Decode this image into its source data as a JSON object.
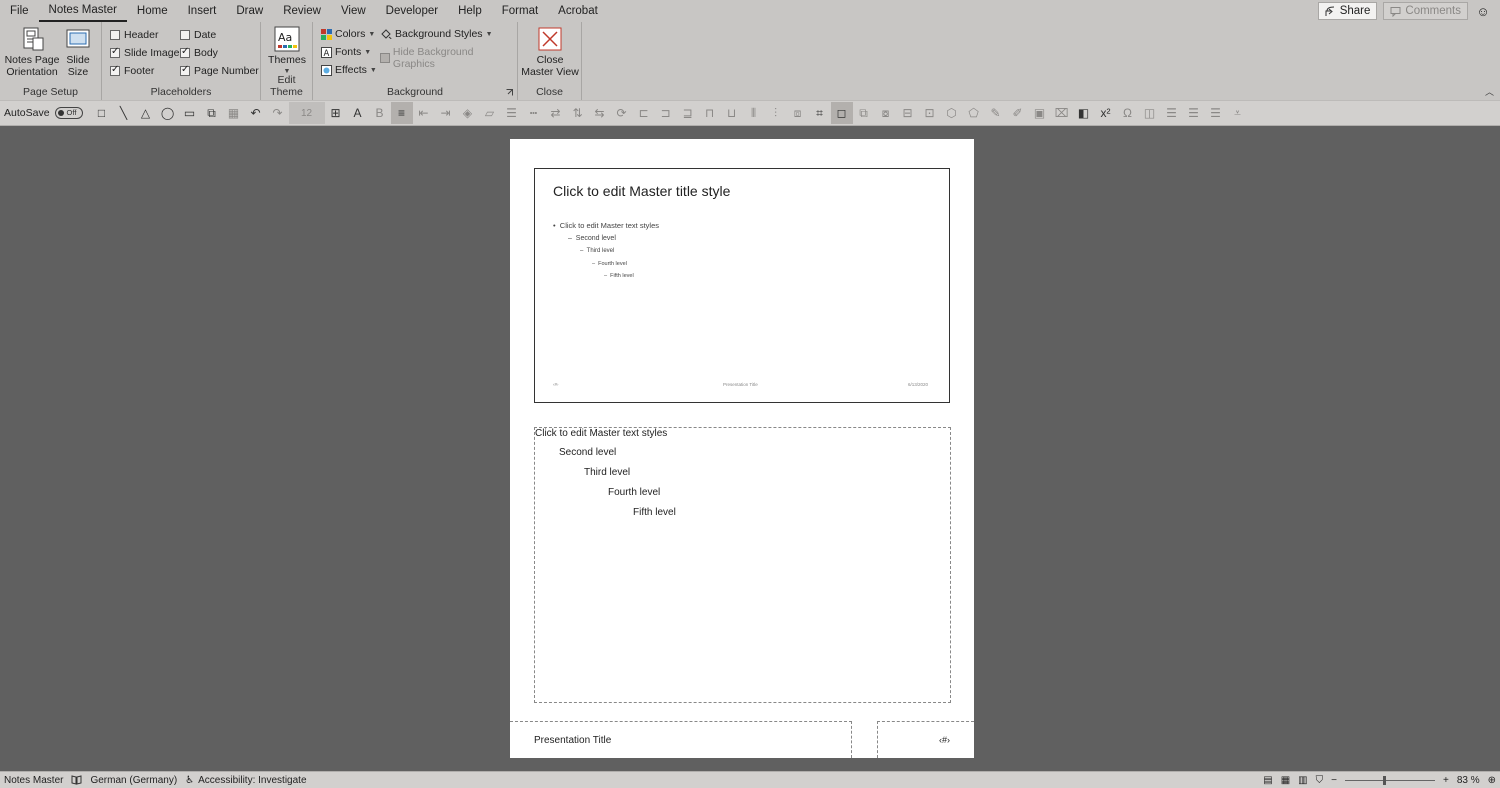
{
  "tabs": [
    "File",
    "Notes Master",
    "Home",
    "Insert",
    "Draw",
    "Review",
    "View",
    "Developer",
    "Help",
    "Format",
    "Acrobat"
  ],
  "active_tab": "Notes Master",
  "header_right": {
    "share": "Share",
    "comments": "Comments"
  },
  "ribbon": {
    "page_setup": {
      "notes_page_orientation": "Notes Page\nOrientation",
      "slide_size": "Slide\nSize",
      "label": "Page Setup"
    },
    "placeholders": {
      "items": [
        {
          "label": "Header",
          "checked": false
        },
        {
          "label": "Slide Image",
          "checked": true
        },
        {
          "label": "Footer",
          "checked": true
        },
        {
          "label": "Date",
          "checked": false
        },
        {
          "label": "Body",
          "checked": true
        },
        {
          "label": "Page Number",
          "checked": true
        }
      ],
      "label": "Placeholders"
    },
    "edit_theme": {
      "themes": "Themes",
      "label": "Edit Theme"
    },
    "background": {
      "colors": "Colors",
      "fonts": "Fonts",
      "effects": "Effects",
      "background_styles": "Background Styles",
      "hide_background_graphics": "Hide Background Graphics",
      "label": "Background"
    },
    "close": {
      "close_master_view": "Close\nMaster View",
      "label": "Close"
    }
  },
  "qat": {
    "autosave": "AutoSave",
    "toggle": "Off",
    "font_size": "12"
  },
  "slide": {
    "title": "Click to edit Master title style",
    "levels": [
      "Click to edit Master text styles",
      "Second level",
      "Third level",
      "Fourth level",
      "Fifth level"
    ],
    "footer_left": "‹#›",
    "footer_center": "Presentation Title",
    "footer_right": "6/13/2020"
  },
  "notes": {
    "levels": [
      "Click to edit Master text styles",
      "Second level",
      "Third level",
      "Fourth level",
      "Fifth level"
    ]
  },
  "page_footer": {
    "title": "Presentation Title",
    "number": "‹#›"
  },
  "status": {
    "mode": "Notes Master",
    "language": "German (Germany)",
    "accessibility": "Accessibility: Investigate",
    "zoom": "83 %"
  }
}
